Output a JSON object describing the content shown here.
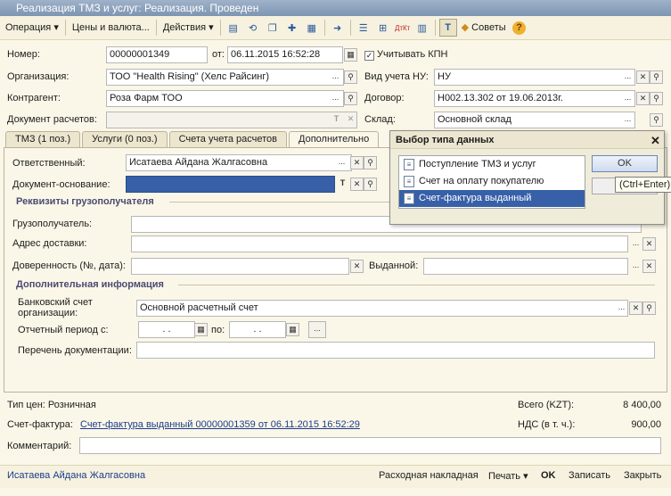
{
  "window": {
    "title": "Реализация ТМЗ и услуг: Реализация. Проведен"
  },
  "toolbar": {
    "operation": "Операция",
    "prices": "Цены и валюта...",
    "actions": "Действия",
    "advice": "Советы",
    "dropdown_icon": "▾"
  },
  "header": {
    "number_label": "Номер:",
    "number_value": "00000001349",
    "date_label": "от:",
    "date_value": "06.11.2015 16:52:28",
    "kpn_label": "Учитывать КПН",
    "kpn_checked": true,
    "org_label": "Организация:",
    "org_value": "ТОО \"Health Rising\" (Хелс Райсинг)",
    "nu_label": "Вид учета НУ:",
    "nu_value": "НУ",
    "contractor_label": "Контрагент:",
    "contractor_value": "Роза Фарм ТОО",
    "contract_label": "Договор:",
    "contract_value": "Н002.13.302 от 19.06.2013г.",
    "settlement_label": "Документ расчетов:",
    "settlement_value": "",
    "warehouse_label": "Склад:",
    "warehouse_value": "Основной склад"
  },
  "tabs": [
    {
      "label": "ТМЗ (1 поз.)"
    },
    {
      "label": "Услуги (0 поз.)"
    },
    {
      "label": "Счета учета расчетов"
    },
    {
      "label": "Дополнительно"
    }
  ],
  "additional": {
    "responsible_label": "Ответственный:",
    "responsible_value": "Исатаева Айдана Жалгасовна",
    "base_doc_label": "Документ-основание:",
    "shipping_section": "Реквизиты грузополучателя",
    "consignee_label": "Грузополучатель:",
    "address_label": "Адрес доставки:",
    "proxy_label": "Доверенность (№, дата):",
    "issued_label": "Выданной:",
    "extra_section": "Дополнительная информация",
    "bank_label_1": "Банковский счет",
    "bank_label_2": "организации:",
    "bank_value": "Основной расчетный счет",
    "period_label": "Отчетный период с:",
    "period_from": ". .",
    "period_to_label": "по:",
    "period_to": ". .",
    "docs_list_label": "Перечень документации:"
  },
  "footer": {
    "price_type": "Тип цен: Розничная",
    "total_label": "Всего (KZT):",
    "total_value": "8 400,00",
    "invoice_label": "Счет-фактура:",
    "invoice_link": "Счет-фактура выданный 00000001359 от 06.11.2015 16:52:29",
    "vat_label": "НДС (в т. ч.):",
    "vat_value": "900,00",
    "comment_label": "Комментарий:",
    "comment_value": ""
  },
  "bottom": {
    "user": "Исатаева Айдана Жалгасовна",
    "invoice_btn": "Расходная накладная",
    "print_btn": "Печать",
    "ok_btn": "OK",
    "save_btn": "Записать",
    "close_btn": "Закрыть"
  },
  "popup": {
    "title": "Выбор типа данных",
    "items": [
      {
        "label": "Поступление ТМЗ и услуг"
      },
      {
        "label": "Счет на оплату покупателю"
      },
      {
        "label": "Счет-фактура выданный"
      }
    ],
    "selected_index": 2,
    "ok": "OK",
    "tooltip": "(Ctrl+Enter)"
  },
  "colors": {
    "background": "#fbf7e8",
    "selection": "#3760a8",
    "section_title": "#4a4a72",
    "link": "#1c3c8c"
  }
}
